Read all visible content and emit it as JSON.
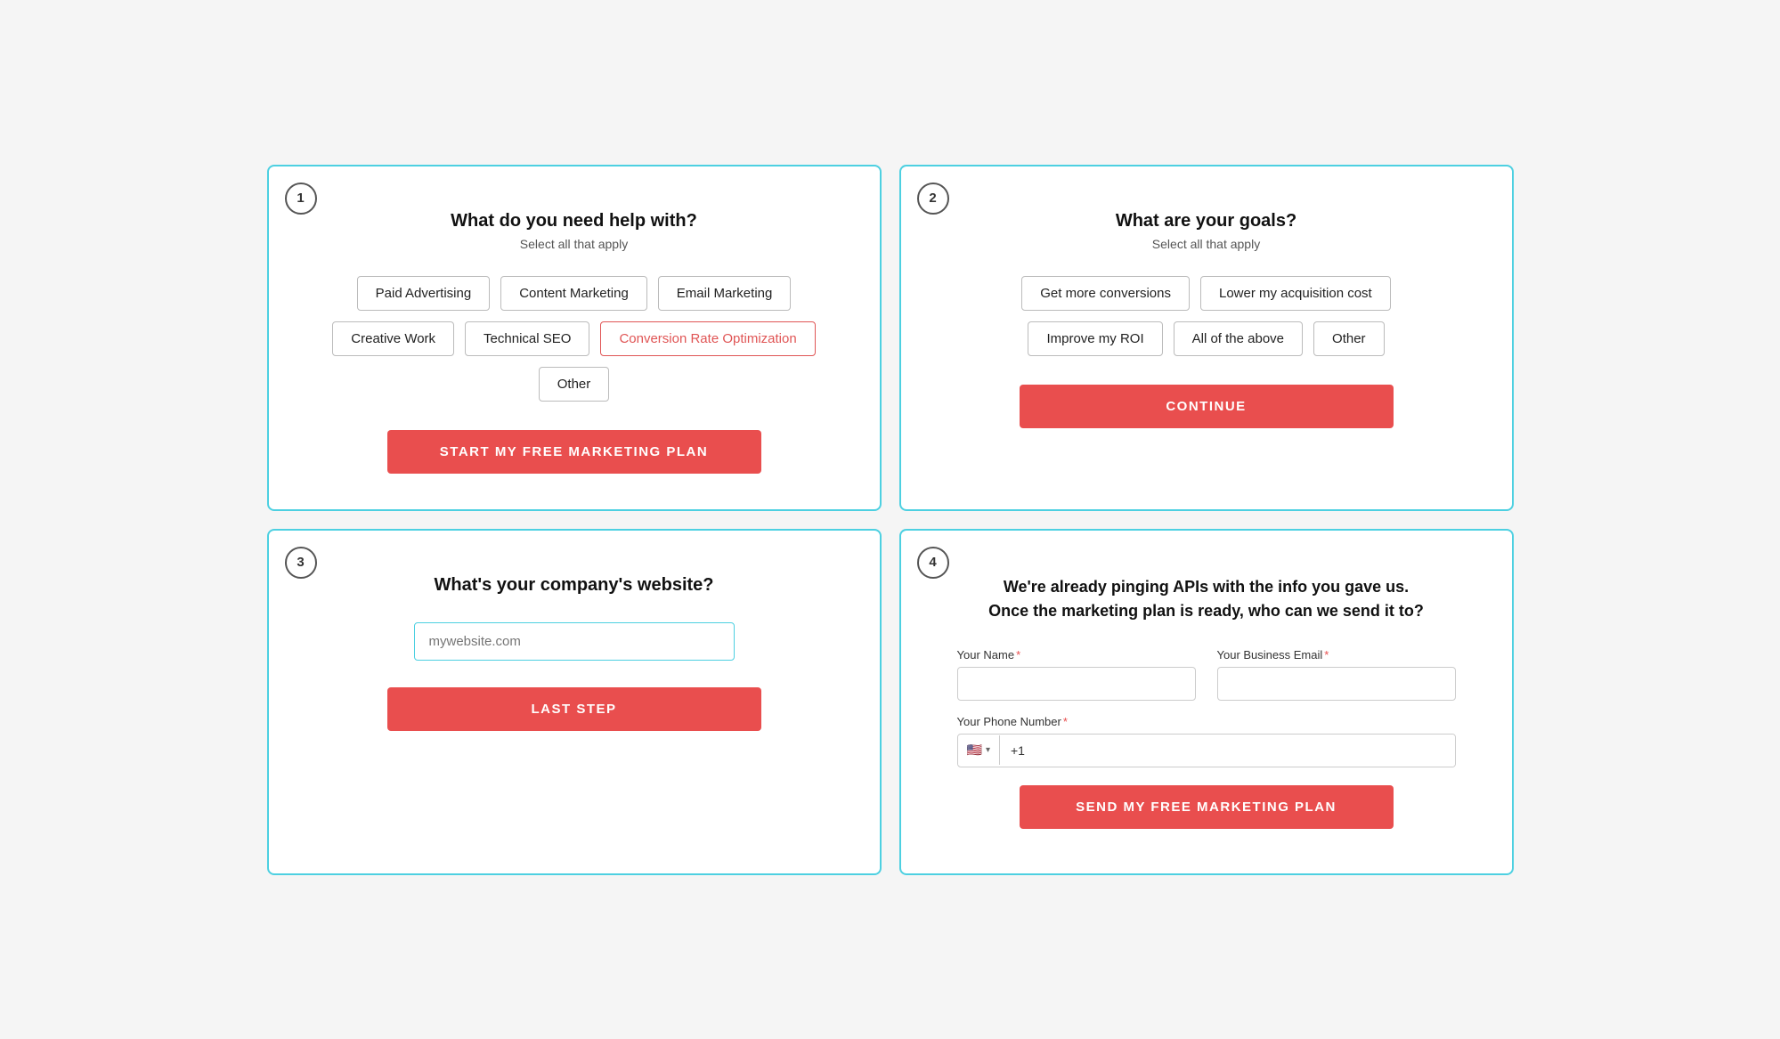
{
  "cards": [
    {
      "step": "1",
      "title": "What do you need help with?",
      "subtitle": "Select all that apply",
      "options_row1": [
        "Paid Advertising",
        "Content Marketing",
        "Email Marketing"
      ],
      "options_row2": [
        "Creative Work",
        "Technical SEO",
        "Conversion Rate Optimization"
      ],
      "options_row3": [
        "Other"
      ],
      "selected": "Conversion Rate Optimization",
      "cta_label": "START MY FREE MARKETING PLAN"
    },
    {
      "step": "2",
      "title": "What are your goals?",
      "subtitle": "Select all that apply",
      "options_row1": [
        "Get more conversions",
        "Lower my acquisition cost"
      ],
      "options_row2": [
        "Improve my ROI",
        "All of the above",
        "Other"
      ],
      "cta_label": "CONTINUE"
    },
    {
      "step": "3",
      "question": "What's your company's website?",
      "placeholder": "mywebsite.com",
      "cta_label": "LAST STEP"
    },
    {
      "step": "4",
      "description_line1": "We're already pinging APIs with the info you gave us.",
      "description_line2": "Once the marketing plan is ready, who can we send it to?",
      "fields": [
        {
          "label": "Your Name",
          "required": true,
          "type": "text",
          "placeholder": ""
        },
        {
          "label": "Your Business Email",
          "required": true,
          "type": "email",
          "placeholder": ""
        }
      ],
      "phone_label": "Your Phone Number",
      "phone_required": true,
      "phone_flag": "🇺🇸",
      "phone_code": "+1",
      "cta_label": "SEND MY FREE MARKETING PLAN"
    }
  ],
  "colors": {
    "border_active": "#4dd0e1",
    "cta_bg": "#e94e4e",
    "selected_option": "#e94e4e"
  }
}
